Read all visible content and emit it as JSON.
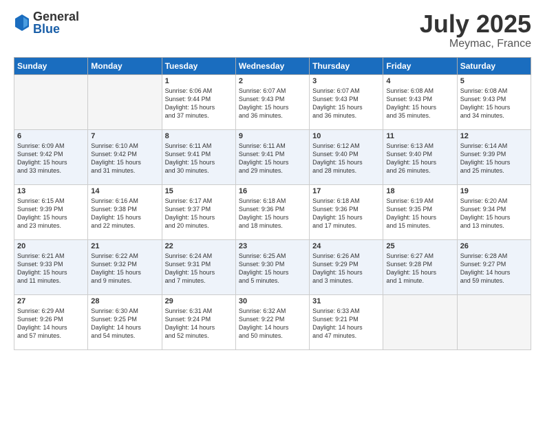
{
  "logo": {
    "general": "General",
    "blue": "Blue"
  },
  "title": {
    "month_year": "July 2025",
    "location": "Meymac, France"
  },
  "weekdays": [
    "Sunday",
    "Monday",
    "Tuesday",
    "Wednesday",
    "Thursday",
    "Friday",
    "Saturday"
  ],
  "weeks": [
    [
      {
        "day": "",
        "lines": []
      },
      {
        "day": "",
        "lines": []
      },
      {
        "day": "1",
        "lines": [
          "Sunrise: 6:06 AM",
          "Sunset: 9:44 PM",
          "Daylight: 15 hours",
          "and 37 minutes."
        ]
      },
      {
        "day": "2",
        "lines": [
          "Sunrise: 6:07 AM",
          "Sunset: 9:43 PM",
          "Daylight: 15 hours",
          "and 36 minutes."
        ]
      },
      {
        "day": "3",
        "lines": [
          "Sunrise: 6:07 AM",
          "Sunset: 9:43 PM",
          "Daylight: 15 hours",
          "and 36 minutes."
        ]
      },
      {
        "day": "4",
        "lines": [
          "Sunrise: 6:08 AM",
          "Sunset: 9:43 PM",
          "Daylight: 15 hours",
          "and 35 minutes."
        ]
      },
      {
        "day": "5",
        "lines": [
          "Sunrise: 6:08 AM",
          "Sunset: 9:43 PM",
          "Daylight: 15 hours",
          "and 34 minutes."
        ]
      }
    ],
    [
      {
        "day": "6",
        "lines": [
          "Sunrise: 6:09 AM",
          "Sunset: 9:42 PM",
          "Daylight: 15 hours",
          "and 33 minutes."
        ]
      },
      {
        "day": "7",
        "lines": [
          "Sunrise: 6:10 AM",
          "Sunset: 9:42 PM",
          "Daylight: 15 hours",
          "and 31 minutes."
        ]
      },
      {
        "day": "8",
        "lines": [
          "Sunrise: 6:11 AM",
          "Sunset: 9:41 PM",
          "Daylight: 15 hours",
          "and 30 minutes."
        ]
      },
      {
        "day": "9",
        "lines": [
          "Sunrise: 6:11 AM",
          "Sunset: 9:41 PM",
          "Daylight: 15 hours",
          "and 29 minutes."
        ]
      },
      {
        "day": "10",
        "lines": [
          "Sunrise: 6:12 AM",
          "Sunset: 9:40 PM",
          "Daylight: 15 hours",
          "and 28 minutes."
        ]
      },
      {
        "day": "11",
        "lines": [
          "Sunrise: 6:13 AM",
          "Sunset: 9:40 PM",
          "Daylight: 15 hours",
          "and 26 minutes."
        ]
      },
      {
        "day": "12",
        "lines": [
          "Sunrise: 6:14 AM",
          "Sunset: 9:39 PM",
          "Daylight: 15 hours",
          "and 25 minutes."
        ]
      }
    ],
    [
      {
        "day": "13",
        "lines": [
          "Sunrise: 6:15 AM",
          "Sunset: 9:39 PM",
          "Daylight: 15 hours",
          "and 23 minutes."
        ]
      },
      {
        "day": "14",
        "lines": [
          "Sunrise: 6:16 AM",
          "Sunset: 9:38 PM",
          "Daylight: 15 hours",
          "and 22 minutes."
        ]
      },
      {
        "day": "15",
        "lines": [
          "Sunrise: 6:17 AM",
          "Sunset: 9:37 PM",
          "Daylight: 15 hours",
          "and 20 minutes."
        ]
      },
      {
        "day": "16",
        "lines": [
          "Sunrise: 6:18 AM",
          "Sunset: 9:36 PM",
          "Daylight: 15 hours",
          "and 18 minutes."
        ]
      },
      {
        "day": "17",
        "lines": [
          "Sunrise: 6:18 AM",
          "Sunset: 9:36 PM",
          "Daylight: 15 hours",
          "and 17 minutes."
        ]
      },
      {
        "day": "18",
        "lines": [
          "Sunrise: 6:19 AM",
          "Sunset: 9:35 PM",
          "Daylight: 15 hours",
          "and 15 minutes."
        ]
      },
      {
        "day": "19",
        "lines": [
          "Sunrise: 6:20 AM",
          "Sunset: 9:34 PM",
          "Daylight: 15 hours",
          "and 13 minutes."
        ]
      }
    ],
    [
      {
        "day": "20",
        "lines": [
          "Sunrise: 6:21 AM",
          "Sunset: 9:33 PM",
          "Daylight: 15 hours",
          "and 11 minutes."
        ]
      },
      {
        "day": "21",
        "lines": [
          "Sunrise: 6:22 AM",
          "Sunset: 9:32 PM",
          "Daylight: 15 hours",
          "and 9 minutes."
        ]
      },
      {
        "day": "22",
        "lines": [
          "Sunrise: 6:24 AM",
          "Sunset: 9:31 PM",
          "Daylight: 15 hours",
          "and 7 minutes."
        ]
      },
      {
        "day": "23",
        "lines": [
          "Sunrise: 6:25 AM",
          "Sunset: 9:30 PM",
          "Daylight: 15 hours",
          "and 5 minutes."
        ]
      },
      {
        "day": "24",
        "lines": [
          "Sunrise: 6:26 AM",
          "Sunset: 9:29 PM",
          "Daylight: 15 hours",
          "and 3 minutes."
        ]
      },
      {
        "day": "25",
        "lines": [
          "Sunrise: 6:27 AM",
          "Sunset: 9:28 PM",
          "Daylight: 15 hours",
          "and 1 minute."
        ]
      },
      {
        "day": "26",
        "lines": [
          "Sunrise: 6:28 AM",
          "Sunset: 9:27 PM",
          "Daylight: 14 hours",
          "and 59 minutes."
        ]
      }
    ],
    [
      {
        "day": "27",
        "lines": [
          "Sunrise: 6:29 AM",
          "Sunset: 9:26 PM",
          "Daylight: 14 hours",
          "and 57 minutes."
        ]
      },
      {
        "day": "28",
        "lines": [
          "Sunrise: 6:30 AM",
          "Sunset: 9:25 PM",
          "Daylight: 14 hours",
          "and 54 minutes."
        ]
      },
      {
        "day": "29",
        "lines": [
          "Sunrise: 6:31 AM",
          "Sunset: 9:24 PM",
          "Daylight: 14 hours",
          "and 52 minutes."
        ]
      },
      {
        "day": "30",
        "lines": [
          "Sunrise: 6:32 AM",
          "Sunset: 9:22 PM",
          "Daylight: 14 hours",
          "and 50 minutes."
        ]
      },
      {
        "day": "31",
        "lines": [
          "Sunrise: 6:33 AM",
          "Sunset: 9:21 PM",
          "Daylight: 14 hours",
          "and 47 minutes."
        ]
      },
      {
        "day": "",
        "lines": []
      },
      {
        "day": "",
        "lines": []
      }
    ]
  ]
}
